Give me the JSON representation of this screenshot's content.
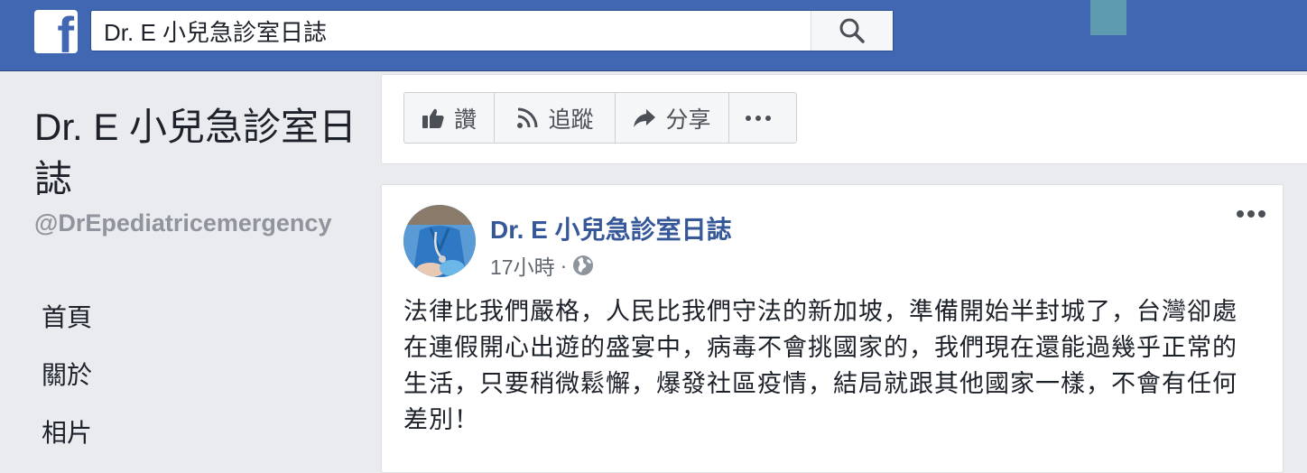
{
  "topbar": {
    "logo_letter": "f",
    "search": {
      "value": "Dr. E 小兒急診室日誌"
    },
    "icons": {
      "search": "search-icon",
      "logo": "facebook-logo"
    },
    "colors": {
      "bar": "#4267b2",
      "accent": "#365899"
    }
  },
  "sidebar": {
    "page_name": "Dr. E 小兒急診室日誌",
    "handle": "@DrEpediatricemergency",
    "items": [
      {
        "label": "首頁"
      },
      {
        "label": "關於"
      },
      {
        "label": "相片"
      }
    ]
  },
  "actions": [
    {
      "label": "讚",
      "icon": "thumbs-up-icon"
    },
    {
      "label": "追蹤",
      "icon": "rss-follow-icon"
    },
    {
      "label": "分享",
      "icon": "share-arrow-icon"
    },
    {
      "label": "",
      "icon": "more-horizontal-icon"
    }
  ],
  "post": {
    "author": "Dr. E 小兒急診室日誌",
    "time": "17小時",
    "separator": "·",
    "privacy_icon": "globe-icon",
    "more_icon": "more-horizontal-icon",
    "body": "法律比我們嚴格，人民比我們守法的新加坡，準備開始半封城了，台灣卻處在連假開心出遊的盛宴中，病毒不會挑國家的，我們現在還能過幾乎正常的生活，只要稍微鬆懈，爆發社區疫情，結局就跟其他國家一樣，不會有任何差別！"
  }
}
